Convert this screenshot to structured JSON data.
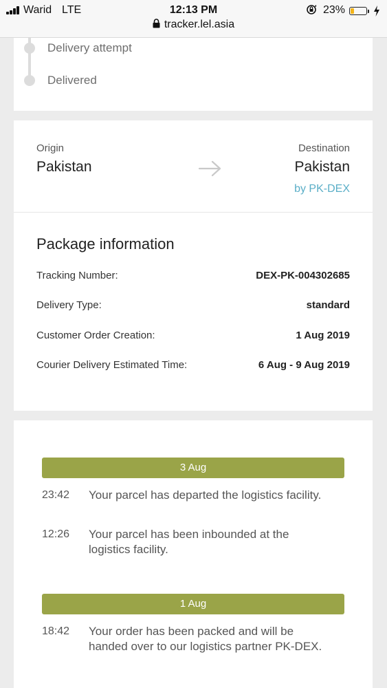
{
  "status_bar": {
    "carrier": "Warid",
    "network": "LTE",
    "time": "12:13 PM",
    "battery_percent": "23%",
    "battery_level": 0.23
  },
  "browser": {
    "url": "tracker.lel.asia"
  },
  "progress_steps": [
    {
      "label": "Delivery attempt"
    },
    {
      "label": "Delivered"
    }
  ],
  "route": {
    "origin_label": "Origin",
    "origin_country": "Pakistan",
    "destination_label": "Destination",
    "destination_country": "Pakistan",
    "carrier": "by PK-DEX"
  },
  "package": {
    "title": "Package information",
    "rows": [
      {
        "label": "Tracking Number:",
        "value": "DEX-PK-004302685"
      },
      {
        "label": "Delivery Type:",
        "value": "standard"
      },
      {
        "label": "Customer Order Creation:",
        "value": "1 Aug 2019"
      },
      {
        "label": "Courier Delivery Estimated Time:",
        "value": "6 Aug - 9 Aug 2019"
      }
    ]
  },
  "timeline": [
    {
      "date": "3 Aug",
      "events": [
        {
          "time": "23:42",
          "text": "Your parcel has departed the logistics facility."
        },
        {
          "time": "12:26",
          "text": "Your parcel has been inbounded at the logistics facility."
        }
      ]
    },
    {
      "date": "1 Aug",
      "events": [
        {
          "time": "18:42",
          "text": "Your order has been packed and will be handed over to our logistics partner PK-DEX."
        }
      ]
    }
  ],
  "colors": {
    "date_bar": "#9aa448",
    "carrier_link": "#5aaec7",
    "battery": "#f3b41a",
    "step_inactive": "#dcdcdc"
  },
  "icons": {
    "lock": "lock-icon",
    "arrow": "arrow-right-icon",
    "orientation_lock": "orientation-lock-icon",
    "charging": "bolt-icon"
  }
}
